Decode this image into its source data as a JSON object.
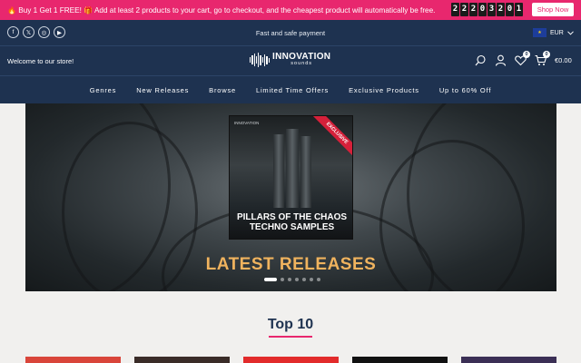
{
  "promo": {
    "fire_emoji": "🔥",
    "text_a": "Buy 1 Get 1 FREE!",
    "gift_emoji": "🎁",
    "text_b": "Add at least 2 products to your cart, go to checkout, and the cheapest product will automatically be free.",
    "countdown": [
      "2",
      "2",
      "2",
      "0",
      "3",
      "2",
      "0",
      "1"
    ],
    "button": "Shop Now"
  },
  "topbar": {
    "social": [
      "f",
      "𝕏",
      "◎",
      "▶"
    ],
    "tagline": "Fast and safe payment",
    "currency": "EUR"
  },
  "header": {
    "welcome": "Welcome to our store!",
    "logo_title": "INNOVATION",
    "logo_sub": "sounds",
    "wishlist_count": "0",
    "cart_count": "0",
    "cart_total": "€0.00"
  },
  "nav": [
    "Genres",
    "New Releases",
    "Browse",
    "Limited Time Offers",
    "Exclusive Products",
    "Up to 60% Off"
  ],
  "hero": {
    "badge": "EXCLUSIVE",
    "cover_title_1": "PILLARS OF THE CHAOS",
    "cover_title_2": "TECHNO SAMPLES",
    "caption": "LATEST RELEASES",
    "slide_count": 7,
    "active_slide": 1
  },
  "top10": {
    "title": "Top 10",
    "thumb_colors": [
      "#d9453a",
      "#3a2c28",
      "#e22b2b",
      "#111111",
      "#3b2f55"
    ]
  },
  "colors": {
    "accent": "#e8276e",
    "navy": "#1e3250",
    "gold": "#f0b35e"
  }
}
